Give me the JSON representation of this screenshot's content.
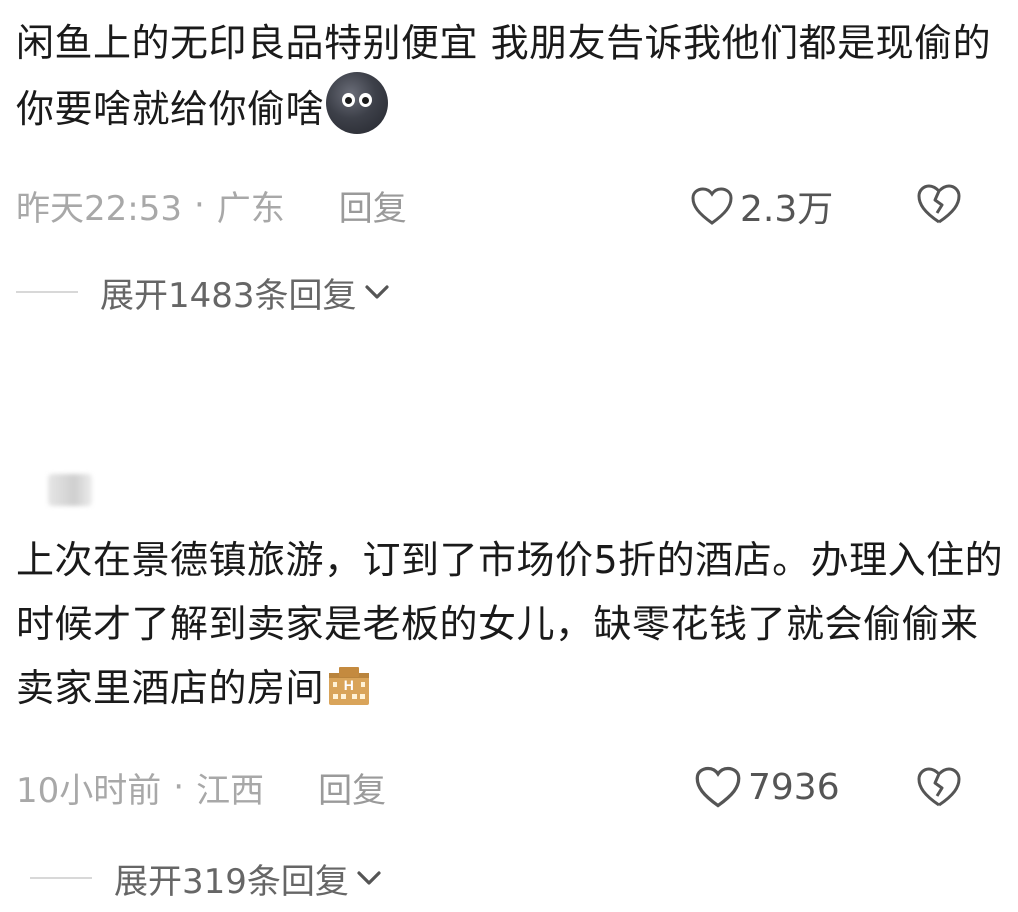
{
  "comment1": {
    "text": "闲鱼上的无印良品特别便宜 我朋友告诉我他们都是现偷的 你要啥就给你偷啥",
    "emoji": "dark-face-emoji",
    "time": "昨天22:53",
    "dot": "·",
    "location": "广东",
    "reply_label": "回复",
    "likes": "2.3万",
    "expand_label": "展开1483条回复"
  },
  "comment2": {
    "text": "上次在景德镇旅游，订到了市场价5折的酒店。办理入住的时候才了解到卖家是老板的女儿，缺零花钱了就会偷偷来卖家里酒店的房间",
    "emoji": "hotel-emoji",
    "time": "10小时前",
    "dot": "·",
    "location": "江西",
    "reply_label": "回复",
    "likes": "7936",
    "expand_label": "展开319条回复"
  },
  "icons": {
    "like": "heart-outline-icon",
    "dislike": "broken-heart-icon",
    "expand": "chevron-down-icon"
  },
  "colors": {
    "text": "#1a1a1a",
    "meta": "#a8a8a8",
    "icon": "#555555"
  }
}
